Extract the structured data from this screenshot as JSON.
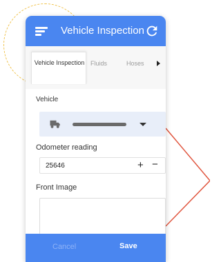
{
  "app": {
    "title": "Vehicle Inspection",
    "accent_color": "#4a86f0",
    "menu_icon": "hamburger-menu-icon",
    "refresh_icon": "refresh-icon"
  },
  "tabs": [
    {
      "label": "Vehicle Inspection",
      "active": true
    },
    {
      "label": "Fluids",
      "active": false
    },
    {
      "label": "Hoses",
      "active": false
    }
  ],
  "form": {
    "vehicle_label": "Vehicle",
    "vehicle_icon": "truck-icon",
    "odometer_label": "Odometer reading",
    "odometer_value": "25646",
    "plus_symbol": "+",
    "minus_symbol": "−",
    "front_image_label": "Front Image"
  },
  "footer": {
    "cancel_label": "Cancel",
    "save_label": "Save"
  }
}
